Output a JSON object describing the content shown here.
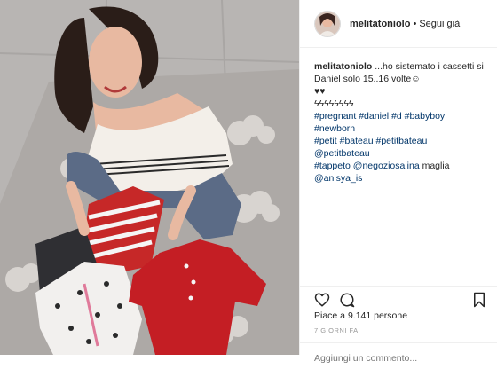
{
  "header": {
    "username": "melitatoniolo",
    "separator": "•",
    "follow_label": "Segui già"
  },
  "caption": {
    "username": "melitatoniolo",
    "text_line1": " ...ho sistemato i cassetti si",
    "text_line2": "Daniel solo 15..16 volte",
    "emoji_face": "☺",
    "hearts": "♥♥",
    "lightning": "ϟϟϟϟϟϟϟϟ",
    "tags_line1": [
      "#pregnant",
      "#daniel",
      "#d",
      "#babyboy",
      "#newborn"
    ],
    "tags_line2": [
      "#petit",
      "#bateau",
      "#petitbateau",
      "@petitbateau"
    ],
    "tags_line3_tags": [
      "#tappeto",
      "@negoziosalina"
    ],
    "tags_line3_text": " maglia",
    "tags_line4": [
      "@anisya_is"
    ]
  },
  "actions": {
    "like_icon": "heart-icon",
    "comment_icon": "comment-icon",
    "save_icon": "bookmark-icon"
  },
  "likes": {
    "label": "Piace a 9.141 persone"
  },
  "time": {
    "label": "7 GIORNI FA"
  },
  "comment": {
    "placeholder": "Aggiungi un commento..."
  },
  "colors": {
    "link": "#003569",
    "text": "#262626",
    "muted": "#999999",
    "border": "#efefef"
  }
}
